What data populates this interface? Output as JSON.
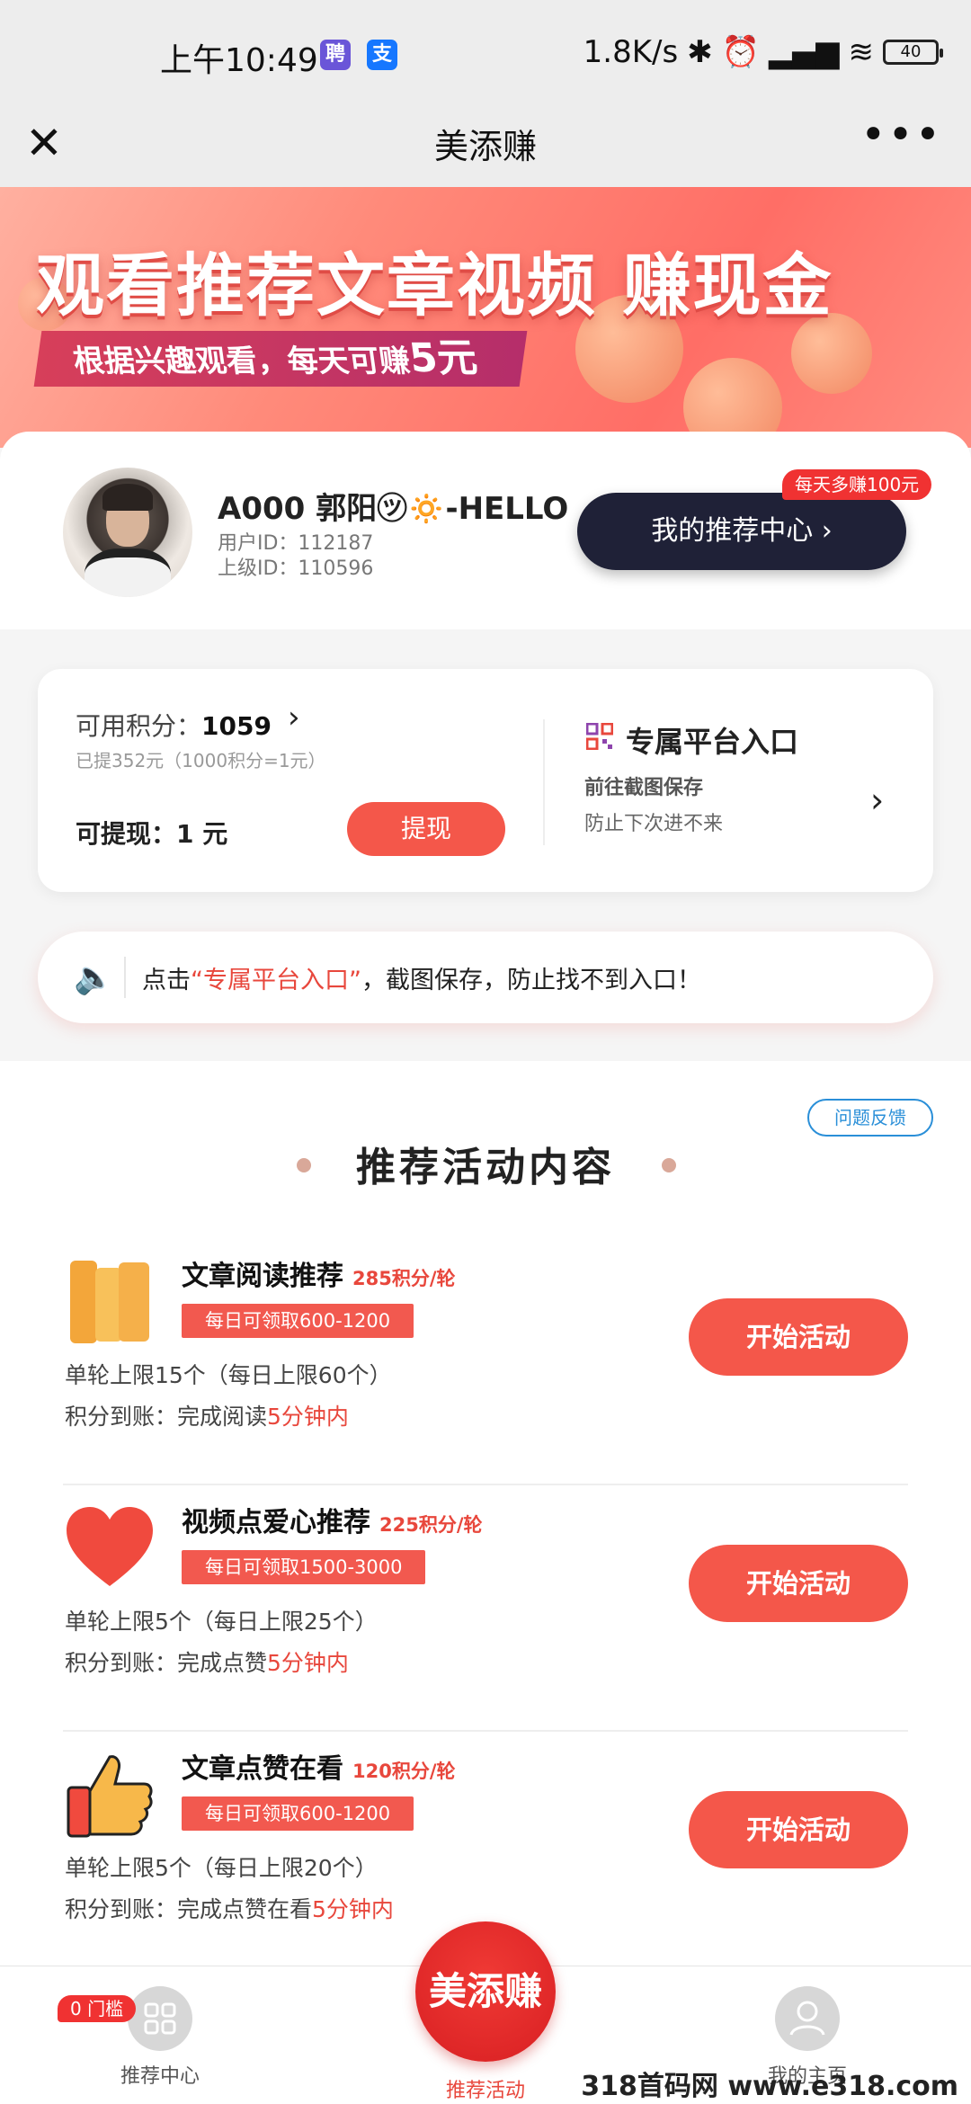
{
  "status_bar": {
    "time": "上午10:49",
    "badge1": "聘",
    "badge2": "支",
    "speed": "1.8K/s",
    "battery": "40",
    "colors": {
      "badge1": "#6a55d8",
      "badge2": "#1677ff"
    }
  },
  "titlebar": {
    "close_icon": "close-icon",
    "title": "美添赚",
    "more_icon": "more-icon"
  },
  "banner": {
    "title": "观看推荐文章视频 赚现金",
    "subtitle_prefix": "根据兴趣观看，每天可赚",
    "subtitle_amount": "5元"
  },
  "profile": {
    "username": "A000 郭阳㋡🔅-HELLO",
    "user_id": "用户ID：112187",
    "parent_id": "上级ID：110596",
    "rec_button": "我的推荐中心 ›",
    "rec_badge": "每天多赚100元"
  },
  "points": {
    "label": "可用积分：",
    "value": "1059",
    "sub": "已提352元（1000积分=1元）",
    "withdrawable": "可提现：1 元",
    "withdraw_button": "提现",
    "platform_title": "专属平台入口",
    "platform_line1": "前往截图保存",
    "platform_line2": "防止下次进不来"
  },
  "notice": {
    "prefix": "点击",
    "highlight": "“专属平台入口”",
    "suffix": "，截图保存，防止找不到入口！"
  },
  "activities": {
    "feedback_button": "问题反馈",
    "section_title": "推荐活动内容",
    "items": [
      {
        "icon": "book-icon",
        "name": "文章阅读推荐",
        "points": "285积分/轮",
        "tag": "每日可领取600-1200",
        "line1": "单轮上限15个（每日上限60个）",
        "line2_prefix": "积分到账：完成阅读",
        "line2_highlight": "5分钟内",
        "button": "开始活动"
      },
      {
        "icon": "heart-icon",
        "name": "视频点爱心推荐",
        "points": "225积分/轮",
        "tag": "每日可领取1500-3000",
        "line1": "单轮上限5个（每日上限25个）",
        "line2_prefix": "积分到账：完成点赞",
        "line2_highlight": "5分钟内",
        "button": "开始活动"
      },
      {
        "icon": "thumbs-up-icon",
        "name": "文章点赞在看",
        "points": "120积分/轮",
        "tag": "每日可领取600-1200",
        "line1": "单轮上限5个（每日上限20个）",
        "line2_prefix": "积分到账：完成点赞在看",
        "line2_highlight": "5分钟内",
        "button": "开始活动"
      }
    ]
  },
  "bottom_nav": {
    "left_label": "推荐中心",
    "left_badge": "0 门槛",
    "center_logo": "美添赚",
    "center_label": "推荐活动",
    "right_label": "我的主页",
    "watermark": "318首码网 www.e318.com"
  }
}
